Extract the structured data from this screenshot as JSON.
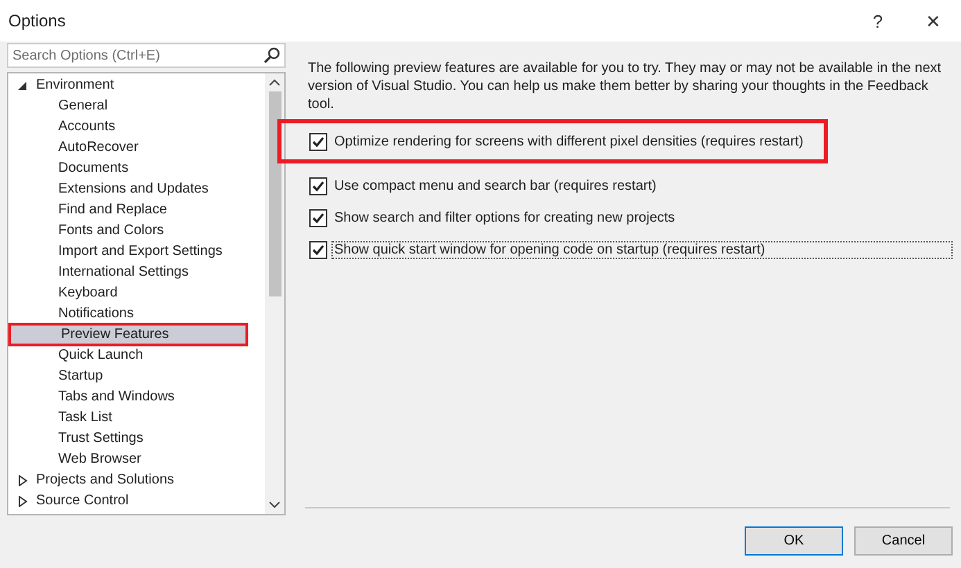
{
  "window": {
    "title": "Options",
    "help": "?",
    "close": "✕"
  },
  "search": {
    "placeholder": "Search Options (Ctrl+E)"
  },
  "tree": [
    {
      "label": "Environment",
      "expanded": true,
      "selected": false,
      "children": [
        {
          "label": "General",
          "selected": false
        },
        {
          "label": "Accounts",
          "selected": false
        },
        {
          "label": "AutoRecover",
          "selected": false
        },
        {
          "label": "Documents",
          "selected": false
        },
        {
          "label": "Extensions and Updates",
          "selected": false
        },
        {
          "label": "Find and Replace",
          "selected": false
        },
        {
          "label": "Fonts and Colors",
          "selected": false
        },
        {
          "label": "Import and Export Settings",
          "selected": false
        },
        {
          "label": "International Settings",
          "selected": false
        },
        {
          "label": "Keyboard",
          "selected": false
        },
        {
          "label": "Notifications",
          "selected": false
        },
        {
          "label": "Preview Features",
          "selected": true
        },
        {
          "label": "Quick Launch",
          "selected": false
        },
        {
          "label": "Startup",
          "selected": false
        },
        {
          "label": "Tabs and Windows",
          "selected": false
        },
        {
          "label": "Task List",
          "selected": false
        },
        {
          "label": "Trust Settings",
          "selected": false
        },
        {
          "label": "Web Browser",
          "selected": false
        }
      ]
    },
    {
      "label": "Projects and Solutions",
      "expanded": false,
      "selected": false
    },
    {
      "label": "Source Control",
      "expanded": false,
      "selected": false
    }
  ],
  "description": "The following preview features are available for you to try. They may or may not be available in the next version of Visual Studio. You can help us make them better by sharing your thoughts in the Feedback tool.",
  "options": [
    {
      "label": "Optimize rendering for screens with different pixel densities (requires restart)",
      "checked": true,
      "focused": false
    },
    {
      "label": "Use compact menu and search bar (requires restart)",
      "checked": true,
      "focused": false
    },
    {
      "label": "Show search and filter options for creating new projects",
      "checked": true,
      "focused": false
    },
    {
      "label": "Show quick start window for opening code on startup (requires restart)",
      "checked": true,
      "focused": true
    }
  ],
  "buttons": [
    {
      "label": "OK",
      "default": true
    },
    {
      "label": "Cancel",
      "default": false
    }
  ]
}
